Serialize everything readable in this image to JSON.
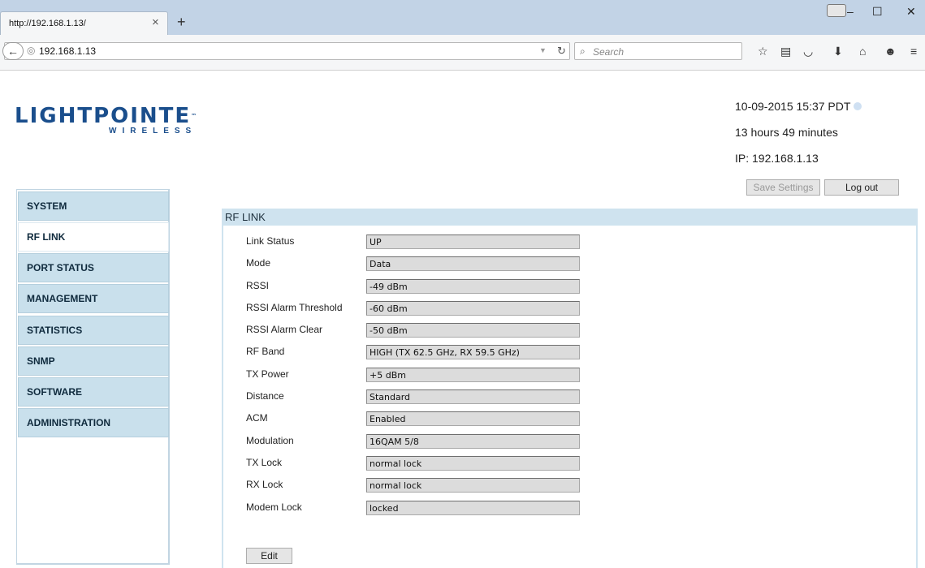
{
  "browser": {
    "tab_title": "http://192.168.1.13/",
    "url": "192.168.1.13",
    "search_placeholder": "Search",
    "icons": [
      "back-arrow-icon",
      "globe-icon",
      "reload-icon",
      "search-icon",
      "bookmark-star-icon",
      "reading-list-icon",
      "pocket-icon",
      "download-icon",
      "home-icon",
      "chat-icon",
      "menu-icon"
    ]
  },
  "logo": {
    "main": "LIGHTPOINTE",
    "sub": "WIRELESS"
  },
  "header_info": {
    "datetime": "10-09-2015 15:37 PDT",
    "uptime": "13 hours 49 minutes",
    "ip": "IP: 192.168.1.13"
  },
  "buttons": {
    "save": "Save Settings",
    "logout": "Log out",
    "edit": "Edit"
  },
  "sidebar": {
    "items": [
      {
        "label": "SYSTEM"
      },
      {
        "label": "RF LINK"
      },
      {
        "label": "PORT STATUS"
      },
      {
        "label": "MANAGEMENT"
      },
      {
        "label": "STATISTICS"
      },
      {
        "label": "SNMP"
      },
      {
        "label": "SOFTWARE"
      },
      {
        "label": "ADMINISTRATION"
      }
    ],
    "active": "RF LINK"
  },
  "panel": {
    "title": "RF LINK",
    "fields": [
      {
        "label": "Link Status",
        "value": "UP"
      },
      {
        "label": "Mode",
        "value": "Data"
      },
      {
        "label": "RSSI",
        "value": "-49 dBm"
      },
      {
        "label": "RSSI Alarm Threshold",
        "value": "-60 dBm"
      },
      {
        "label": "RSSI Alarm Clear",
        "value": "-50 dBm"
      },
      {
        "label": "RF Band",
        "value": "HIGH (TX 62.5 GHz, RX 59.5 GHz)"
      },
      {
        "label": "TX Power",
        "value": "+5 dBm"
      },
      {
        "label": "Distance",
        "value": "Standard"
      },
      {
        "label": "ACM",
        "value": "Enabled"
      },
      {
        "label": "Modulation",
        "value": "16QAM 5/8"
      },
      {
        "label": "TX Lock",
        "value": "normal lock"
      },
      {
        "label": "RX Lock",
        "value": "normal lock"
      },
      {
        "label": "Modem Lock",
        "value": "locked"
      }
    ]
  }
}
